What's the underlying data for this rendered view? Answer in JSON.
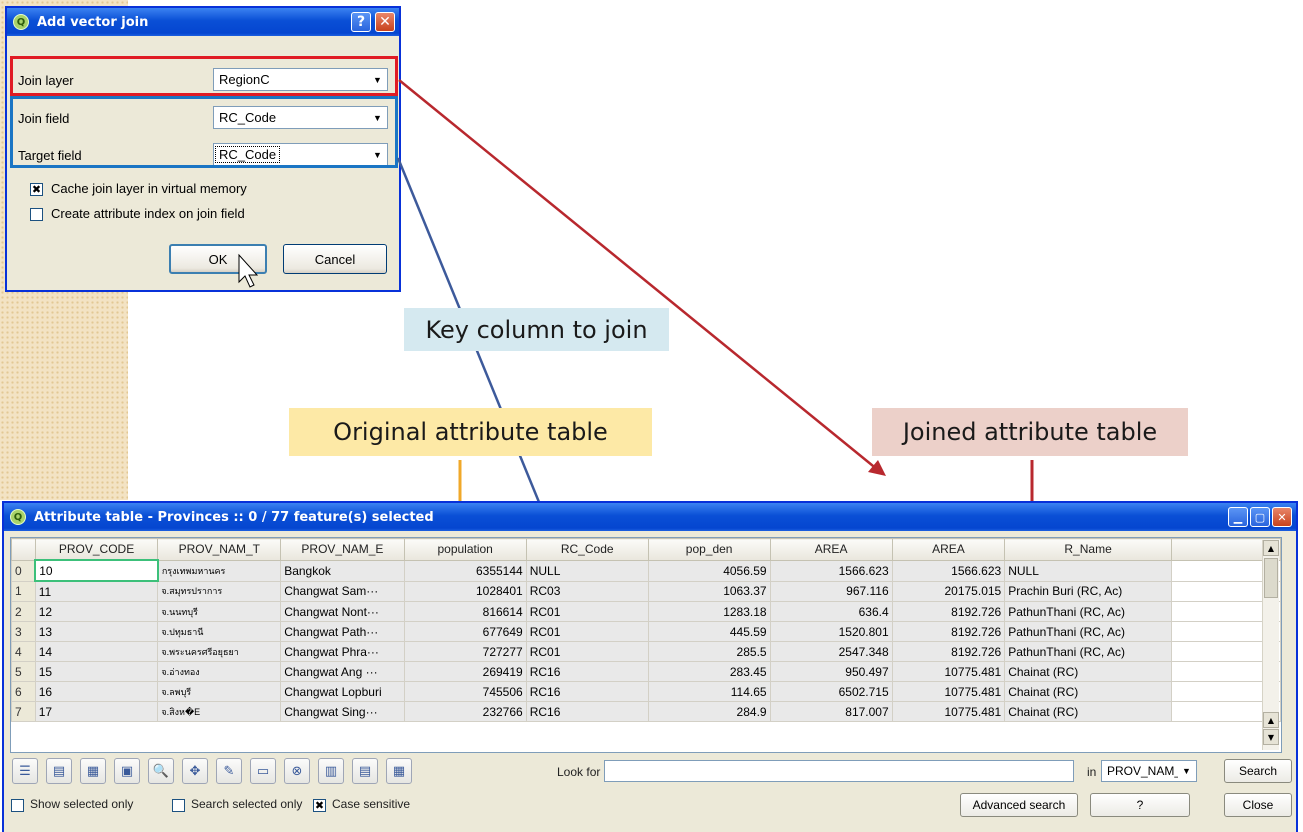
{
  "dialog": {
    "title": "Add vector join",
    "join_layer_label": "Join layer",
    "join_layer_value": "RegionC",
    "join_field_label": "Join field",
    "join_field_value": "RC_Code",
    "target_field_label": "Target field",
    "target_field_value": "RC_Code",
    "cache_label": "Cache join layer in virtual memory",
    "cache_checked": true,
    "index_label": "Create attribute index on join field",
    "index_checked": false,
    "ok_label": "OK",
    "cancel_label": "Cancel"
  },
  "callouts": {
    "key_column": "Key column to join",
    "original_table": "Original attribute table",
    "joined_table": "Joined attribute table"
  },
  "colors": {
    "red_highlight": "#e01b24",
    "blue_highlight": "#1a75c4",
    "orange_bracket": "#f0a82a",
    "dark_red_bracket": "#b8282e",
    "callout_blue_bg": "#d5e9f0",
    "callout_yellow_bg": "#fde9a6",
    "callout_pink_bg": "#ecd0c9"
  },
  "attribute_table": {
    "title": "Attribute table - Provinces :: 0 / 77 feature(s) selected",
    "columns": [
      "PROV_CODE",
      "PROV_NAM_T",
      "PROV_NAM_E",
      "population",
      "RC_Code",
      "pop_den",
      "AREA",
      "AREA",
      "R_Name"
    ],
    "rows": [
      [
        "0",
        "10",
        "กรุงเทพมหานคร",
        "Bangkok",
        "6355144",
        "NULL",
        "4056.59",
        "1566.623",
        "1566.623",
        "NULL"
      ],
      [
        "1",
        "11",
        "จ.สมุทรปราการ",
        "Changwat Sam···",
        "1028401",
        "RC03",
        "1063.37",
        "967.116",
        "20175.015",
        "Prachin Buri (RC, Ac)"
      ],
      [
        "2",
        "12",
        "จ.นนทบุรี",
        "Changwat Nont···",
        "816614",
        "RC01",
        "1283.18",
        "636.4",
        "8192.726",
        "PathunThani (RC, Ac)"
      ],
      [
        "3",
        "13",
        "จ.ปทุมธานี",
        "Changwat Path···",
        "677649",
        "RC01",
        "445.59",
        "1520.801",
        "8192.726",
        "PathunThani (RC, Ac)"
      ],
      [
        "4",
        "14",
        "จ.พระนครศรีอยุธยา",
        "Changwat Phra···",
        "727277",
        "RC01",
        "285.5",
        "2547.348",
        "8192.726",
        "PathunThani (RC, Ac)"
      ],
      [
        "5",
        "15",
        "จ.อ่างทอง",
        "Changwat Ang ···",
        "269419",
        "RC16",
        "283.45",
        "950.497",
        "10775.481",
        "Chainat (RC)"
      ],
      [
        "6",
        "16",
        "จ.ลพบุรี",
        "Changwat Lopburi",
        "745506",
        "RC16",
        "114.65",
        "6502.715",
        "10775.481",
        "Chainat (RC)"
      ],
      [
        "7",
        "17",
        "จ.สิงห�E",
        "Changwat Sing···",
        "232766",
        "RC16",
        "284.9",
        "817.007",
        "10775.481",
        "Chainat (RC)"
      ]
    ],
    "look_for_label": "Look for",
    "look_for_value": "",
    "in_label": "in",
    "in_field": "PROV_NAM_E",
    "search_label": "Search",
    "show_selected_label": "Show selected only",
    "search_selected_label": "Search selected only",
    "case_sensitive_label": "Case sensitive",
    "case_sensitive_checked": true,
    "advanced_search_label": "Advanced search",
    "help_label": "?",
    "close_label": "Close"
  },
  "toolbar_icons": [
    "table-icon",
    "select-all-icon",
    "invert-selection-icon",
    "selected-to-top-icon",
    "zoom-to-selection-icon",
    "pan-to-selection-icon",
    "edit-pencil-icon",
    "save-icon",
    "delete-icon",
    "new-column-icon",
    "delete-column-icon",
    "field-calculator-icon"
  ]
}
